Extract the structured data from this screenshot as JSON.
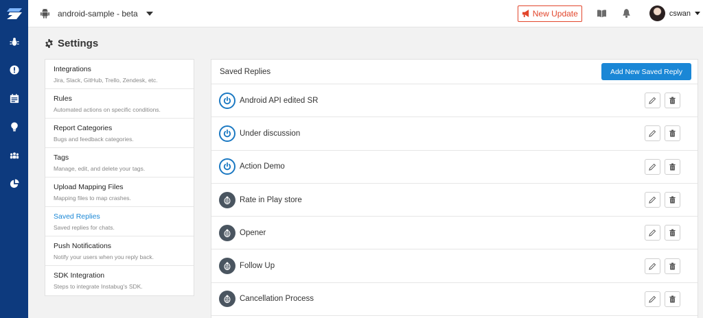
{
  "app": {
    "name": "android-sample - beta",
    "platform_icon": "android-icon"
  },
  "header": {
    "new_update_label": "New Update",
    "icons": [
      "megaphone-icon",
      "book-icon",
      "bell-icon"
    ],
    "user_name": "cswan"
  },
  "rail": {
    "items": [
      "bug-icon",
      "alert-icon",
      "calendar-icon",
      "lightbulb-icon",
      "users-icon",
      "pie-chart-icon"
    ]
  },
  "page": {
    "title": "Settings"
  },
  "nav": {
    "items": [
      {
        "title": "Integrations",
        "desc": "Jira, Slack, GitHub, Trello, Zendesk, etc."
      },
      {
        "title": "Rules",
        "desc": "Automated actions on specific conditions."
      },
      {
        "title": "Report Categories",
        "desc": "Bugs and feedback categories."
      },
      {
        "title": "Tags",
        "desc": "Manage, edit, and delete your tags."
      },
      {
        "title": "Upload Mapping Files",
        "desc": "Mapping files to map crashes."
      },
      {
        "title": "Saved Replies",
        "desc": "Saved replies for chats."
      },
      {
        "title": "Push Notifications",
        "desc": "Notify your users when you reply back."
      },
      {
        "title": "SDK Integration",
        "desc": "Steps to integrate Instabug's SDK."
      }
    ],
    "active": "Saved Replies"
  },
  "panel": {
    "title": "Saved Replies",
    "add_label": "Add New Saved Reply",
    "replies": [
      {
        "name": "Android API edited SR",
        "icon": "power-icon"
      },
      {
        "name": "Under discussion",
        "icon": "power-icon"
      },
      {
        "name": "Action Demo",
        "icon": "power-icon"
      },
      {
        "name": "Rate in Play store",
        "icon": "ladybug-icon"
      },
      {
        "name": "Opener",
        "icon": "ladybug-icon"
      },
      {
        "name": "Follow Up",
        "icon": "ladybug-icon"
      },
      {
        "name": "Cancellation Process",
        "icon": "ladybug-icon"
      }
    ]
  },
  "colors": {
    "rail": "#0d3a7e",
    "accent": "#1a87d6",
    "update": "#e2452b"
  }
}
